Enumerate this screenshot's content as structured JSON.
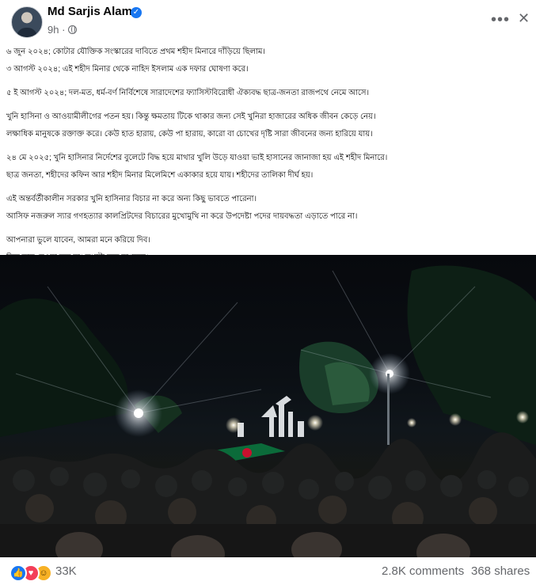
{
  "post": {
    "author": "Md Sarjis Alam",
    "time": "9h",
    "body": [
      [
        "৬ জুন ২০২৪; কোটার যৌক্তিক সংস্কারের দাবিতে প্রথম শহীদ মিনারে দাঁড়িয়ে ছিলাম।",
        "৩ আগস্ট ২০২৪; এই শহীদ মিনার থেকে নাহিদ ইসলাম এক দফার ঘোষণা করে।"
      ],
      [
        "৫ ই আগস্ট ২০২৪; দল-মত, ধর্ম-বর্ণ নির্বিশেষে সারাদেশের ফ্যাসিস্টবিরোধী ঐক্যবদ্ধ ছাত্র-জনতা রাজপথে নেমে আসে।"
      ],
      [
        "খুনি হাসিনা ও আওয়ামীলীগের পতন হয়। কিন্তু ক্ষমতায় টিকে থাকার জন্য সেই খুনিরা হাজারের অধিক জীবন কেড়ে নেয়।",
        "লক্ষাধিক মানুষকে রক্তাক্ত করে। কেউ হাত হারায়, কেউ পা হারায়, কারো বা চোখের দৃষ্টি সারা জীবনের জন্য হারিয়ে যায়।"
      ],
      [
        "২৪ মে ২০২৫; খুনি হাসিনার নির্দেশের বুলেটে বিদ্ধ হয়ে মাথার খুলি উড়ে যাওয়া ভাই হাসানের জানাজা হয় এই শহীদ মিনারে।",
        "ছাত্র জনতা, শহীদের কফিন আর শহীদ মিনার মিলেমিশে একাকার হয়ে যায়। শহীদের তালিকা দীর্ঘ হয়।"
      ],
      [
        "এই অন্তর্বর্তীকালীন সরকার খুনি হাসিনার বিচার না করে অন্য কিছু ভাবতে পারেনা।",
        "আসিফ নজরুল স্যার গণহত্যার কালপ্রিটদের বিচারের মুখোমুখি না করে উপদেষ্টা পদের দায়বদ্ধতা এড়াতে পারে না।"
      ],
      [
        "আপনারা ভুলে যাবেন, আমরা মনে করিয়ে দিব।",
        "কিন্তু ছাড় দেওয়া হবে না। কথাটা মনে রাখবেন।"
      ]
    ]
  },
  "footer": {
    "reaction_count": "33K",
    "comments": "2.8K comments",
    "shares": "368 shares"
  },
  "icons": {
    "like": "like-icon",
    "love": "love-icon",
    "haha": "haha-icon",
    "more": "more-options-icon",
    "close": "close-icon",
    "verified": "verified-badge-icon",
    "privacy": "globe-icon"
  },
  "colors": {
    "brand_blue": "#1877f2",
    "love_red": "#f33e58",
    "haha_yellow": "#f7b125",
    "secondary_text": "#65676b"
  }
}
